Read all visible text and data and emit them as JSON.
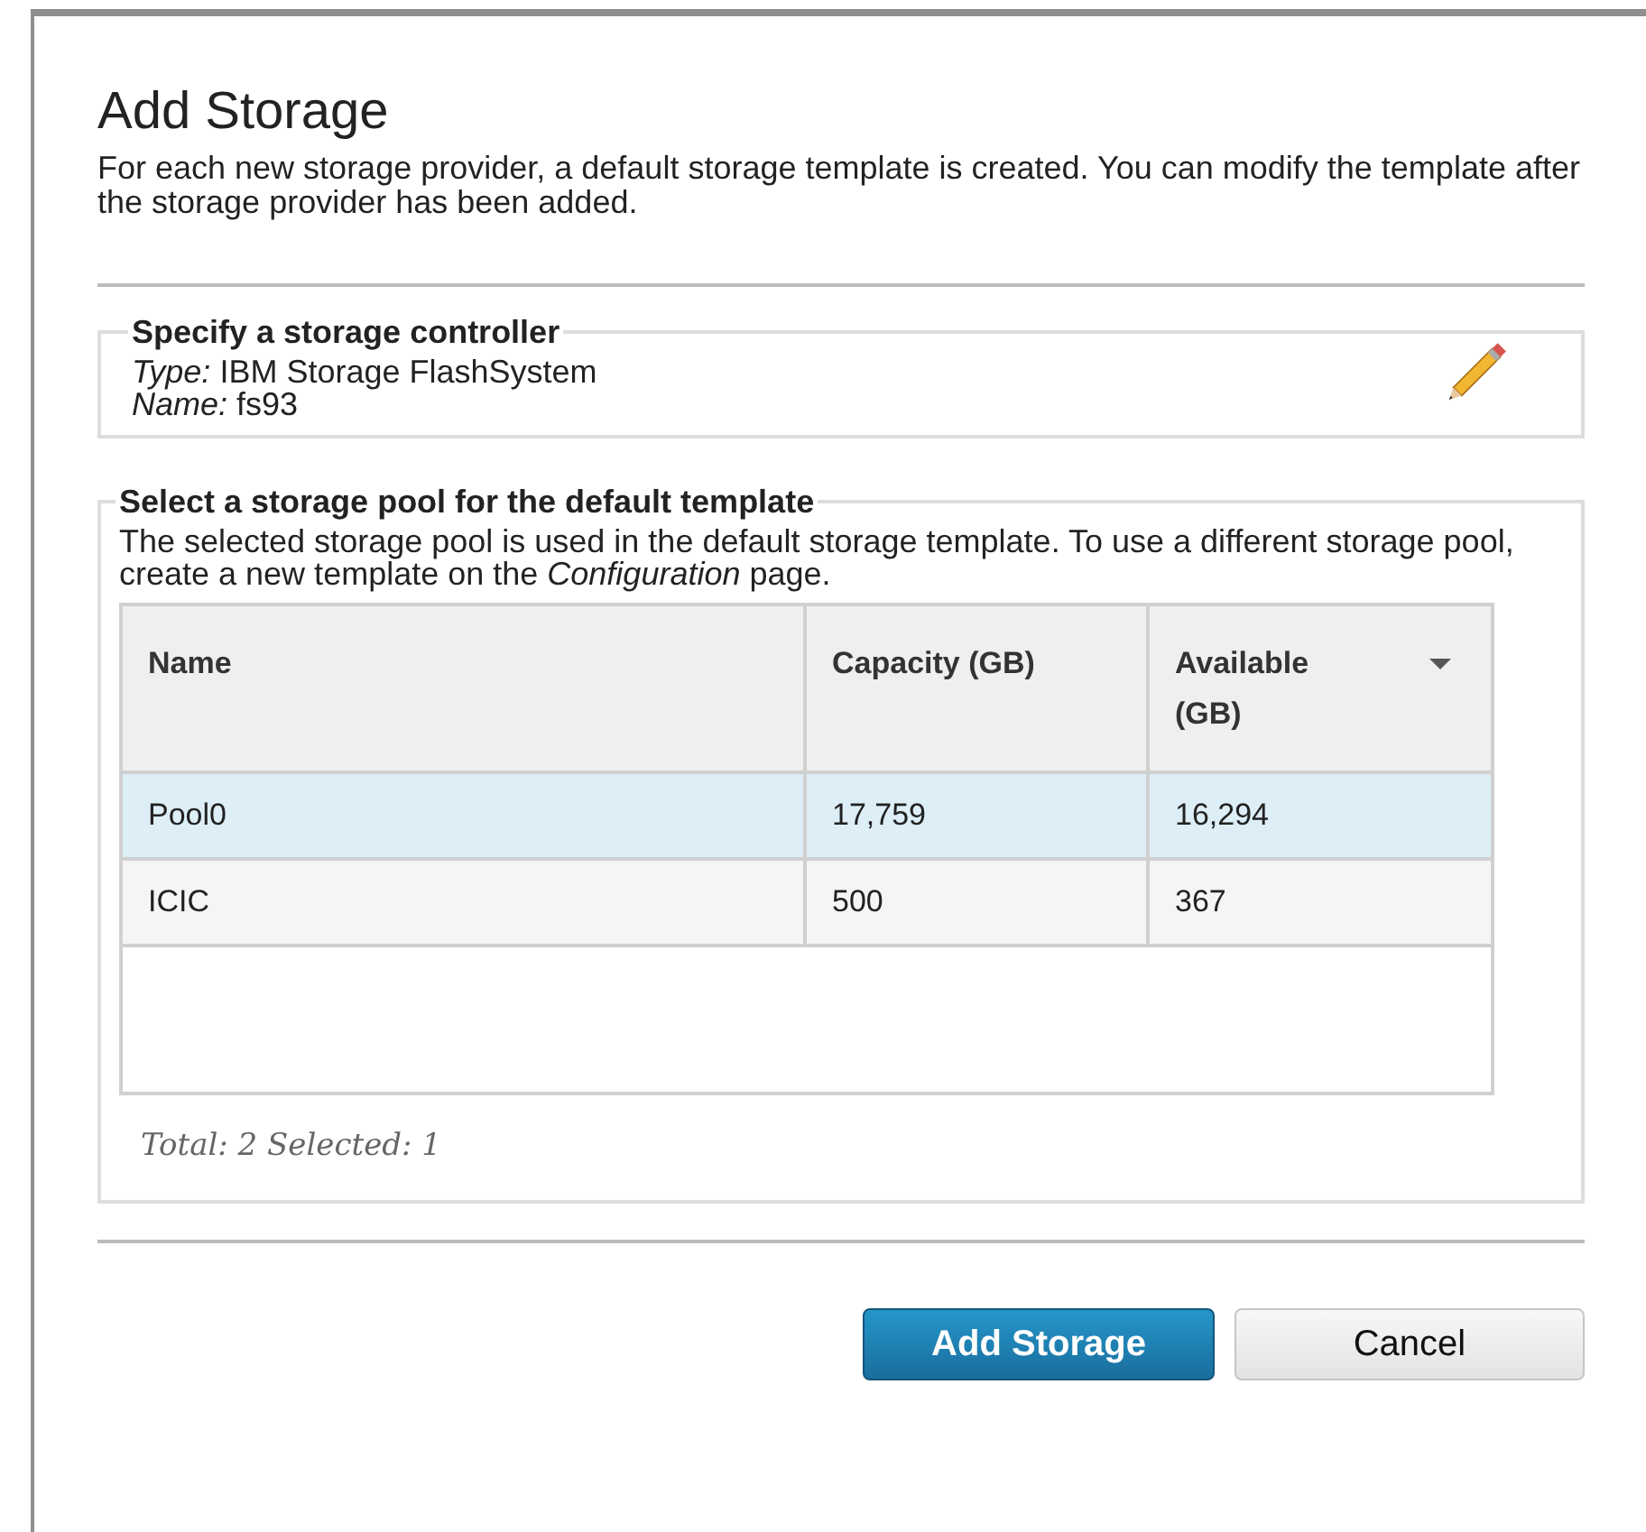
{
  "dialog": {
    "title": "Add Storage",
    "description": "For each new storage provider, a default storage template is created. You can modify the template after the storage provider has been added."
  },
  "controller": {
    "legend": "Specify a storage controller",
    "lines": [
      "*Type:* IBM Storage FlashSystem",
      "*Name:* fs93"
    ]
  },
  "pool": {
    "legend": "Select a storage pool for the default template",
    "description": "The selected storage pool is used in the default storage template. To use a different storage pool, create a new template on the *Configuration* page.",
    "table": {
      "columns": [
        {
          "label": "Name",
          "sorted": false
        },
        {
          "label": "Capacity (GB)",
          "sorted": false
        },
        {
          "label": "Available (GB)",
          "sorted": true
        }
      ],
      "rows": [
        {
          "cells": [
            "Pool0",
            "17,759",
            "16,294"
          ],
          "selected": true
        },
        {
          "cells": [
            "ICIC",
            "500",
            "367"
          ],
          "selected": false
        }
      ]
    },
    "footer": "Total: 2 Selected: 1"
  },
  "buttons": [
    {
      "label": "Add Storage",
      "kind": "primary"
    },
    {
      "label": "Cancel",
      "kind": "secondary"
    }
  ]
}
